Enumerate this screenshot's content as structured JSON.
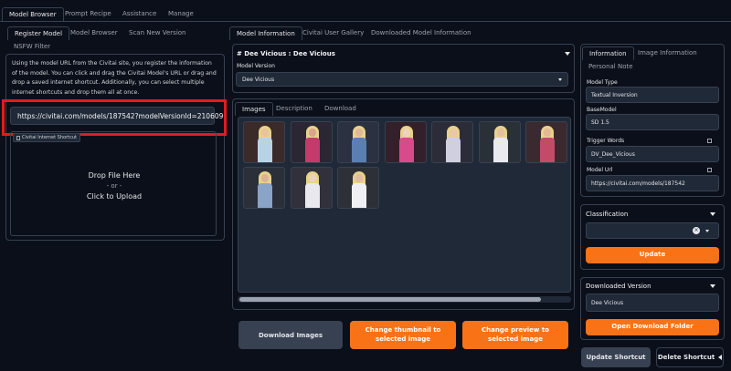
{
  "main_tabs": [
    "Model Browser",
    "Prompt Recipe",
    "Assistance",
    "Manage"
  ],
  "left": {
    "tabs": [
      "Register Model",
      "Model Browser",
      "Scan New Version",
      "NSFW Filter"
    ],
    "description": "Using the model URL from the Civitai site, you register the information of the model. You can click and drag the Civitai Model's URL or drag and drop a saved internet shortcut. Additionally, you can select multiple internet shortcuts and drop them all at once.",
    "url_value": "https://civitai.com/models/187542?modelVersionId=210609",
    "shortcut_label": "Civitai Internet Shortcut",
    "drop_line1": "Drop File Here",
    "drop_line2": "- or -",
    "drop_line3": "Click to Upload"
  },
  "center": {
    "tabs": [
      "Model Information",
      "Civitai User Gallery",
      "Downloaded Model Information"
    ],
    "model_title": "# Dee Vicious : Dee Vicious",
    "model_version_label": "Model Version",
    "model_version_value": "Dee Vicious",
    "gallery_tabs": [
      "Images",
      "Description",
      "Download"
    ],
    "thumbnail_count": 10,
    "download_images_button": "Download Images",
    "change_thumbnail_button": "Change thumbnail to selected image",
    "change_preview_button": "Change preview to selected image"
  },
  "right": {
    "tabs": [
      "Information",
      "Image Information",
      "Personal Note"
    ],
    "model_type_label": "Model Type",
    "model_type_value": "Textual Inversion",
    "basemodel_label": "BaseModel",
    "basemodel_value": "SD 1.5",
    "trigger_words_label": "Trigger Words",
    "trigger_words_value": "DV_Dee_Vicious",
    "model_url_label": "Model Url",
    "model_url_value": "https://civitai.com/models/187542",
    "classification_label": "Classification",
    "update_button": "Update",
    "downloaded_version_label": "Downloaded Version",
    "downloaded_version_value": "Dee Vicious",
    "open_download_folder_button": "Open Download Folder",
    "update_shortcut_button": "Update Shortcut",
    "delete_shortcut_button": "Delete Shortcut"
  },
  "colors": {
    "accent": "#f97316",
    "highlight_box": "#e11d1d",
    "background": "#0b0f19",
    "panel": "#1f2937"
  }
}
